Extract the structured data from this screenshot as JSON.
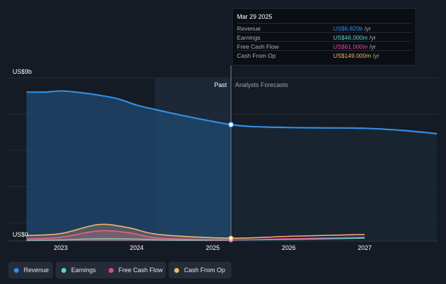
{
  "chart_data": {
    "type": "area",
    "y_axis": {
      "top_label": "US$9b",
      "bottom_label": "US$0",
      "ylim": [
        0,
        9
      ]
    },
    "x_ticks": [
      "2023",
      "2024",
      "2025",
      "2026",
      "2027"
    ],
    "xlim": [
      2022.55,
      2027.95
    ],
    "divider_x": 2025.24,
    "shaded_start_x": 2024.24,
    "past_label": "Past",
    "forecast_label": "Analysts Forecasts",
    "series": [
      {
        "name": "Revenue",
        "color": "#2f8fe6",
        "points": [
          [
            2022.55,
            8.22
          ],
          [
            2022.8,
            8.22
          ],
          [
            2023.0,
            8.28
          ],
          [
            2023.2,
            8.22
          ],
          [
            2023.5,
            8.05
          ],
          [
            2023.75,
            7.85
          ],
          [
            2024.0,
            7.5
          ],
          [
            2024.25,
            7.25
          ],
          [
            2024.5,
            7.02
          ],
          [
            2024.75,
            6.8
          ],
          [
            2025.0,
            6.6
          ],
          [
            2025.24,
            6.42
          ],
          [
            2025.5,
            6.32
          ],
          [
            2026.0,
            6.26
          ],
          [
            2026.5,
            6.24
          ],
          [
            2027.0,
            6.22
          ],
          [
            2027.5,
            6.1
          ],
          [
            2027.95,
            5.92
          ]
        ]
      },
      {
        "name": "Earnings",
        "color": "#4fd9d4",
        "points": [
          [
            2022.55,
            0.02
          ],
          [
            2023.0,
            0.05
          ],
          [
            2023.5,
            0.12
          ],
          [
            2024.0,
            0.1
          ],
          [
            2024.5,
            0.04
          ],
          [
            2025.24,
            0.046
          ],
          [
            2026.0,
            0.08
          ],
          [
            2027.0,
            0.15
          ]
        ]
      },
      {
        "name": "Free Cash Flow",
        "color": "#e0489a",
        "points": [
          [
            2022.55,
            0.1
          ],
          [
            2023.0,
            0.2
          ],
          [
            2023.5,
            0.55
          ],
          [
            2023.9,
            0.45
          ],
          [
            2024.3,
            0.15
          ],
          [
            2025.24,
            0.061
          ],
          [
            2026.0,
            0.12
          ],
          [
            2027.0,
            0.2
          ]
        ]
      },
      {
        "name": "Cash From Op",
        "color": "#f2b56b",
        "points": [
          [
            2022.55,
            0.3
          ],
          [
            2023.0,
            0.4
          ],
          [
            2023.5,
            0.9
          ],
          [
            2023.9,
            0.72
          ],
          [
            2024.3,
            0.35
          ],
          [
            2025.24,
            0.149
          ],
          [
            2026.0,
            0.25
          ],
          [
            2027.0,
            0.35
          ]
        ]
      }
    ],
    "tooltip": {
      "date": "Mar 29 2025",
      "rows": [
        {
          "label": "Revenue",
          "value": "US$6.820b",
          "unit": "/yr",
          "color": "#2f8fe6"
        },
        {
          "label": "Earnings",
          "value": "US$46.000m",
          "unit": "/yr",
          "color": "#4fd9d4"
        },
        {
          "label": "Free Cash Flow",
          "value": "US$61.000m",
          "unit": "/yr",
          "color": "#e0489a"
        },
        {
          "label": "Cash From Op",
          "value": "US$149.000m",
          "unit": "/yr",
          "color": "#f2b56b"
        }
      ]
    }
  },
  "legend": [
    {
      "label": "Revenue",
      "color": "#2f8fe6"
    },
    {
      "label": "Earnings",
      "color": "#4fd9d4"
    },
    {
      "label": "Free Cash Flow",
      "color": "#e0489a"
    },
    {
      "label": "Cash From Op",
      "color": "#f2b56b"
    }
  ]
}
